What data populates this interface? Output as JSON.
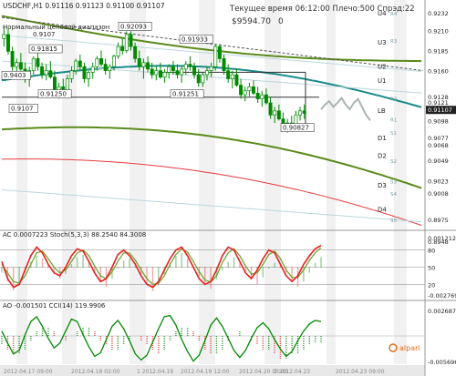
{
  "header": {
    "symbol_line": "USDCHF,H1  0.91116 0.91123 0.91100 0.91107",
    "channel_note": "Нормальный ценовой диапазон",
    "channel_value": "0.9107",
    "server_time": "Текущее время 06:12:00 Плечо:500 Спрэд:22",
    "balance": "$9594.70",
    "balance_change": "0"
  },
  "colors": {
    "background": "#ffffff",
    "gridband": "#e6e6e6",
    "candle": "#008a00",
    "teal_ma": "#1a8a8a",
    "olive_ma": "#5a8a1a",
    "red_ma": "#e83a3a",
    "stoch_red": "#e82020",
    "stoch_green": "#6aa020",
    "hist_red": "#e05050",
    "hist_green": "#3a9a3a"
  },
  "chart_data": [
    {
      "type": "line",
      "title": "USDCHF,H1",
      "ylim": [
        0.8965,
        0.9232
      ],
      "price_axis_labels": [
        "0.9232",
        "0.9210",
        "0.9185",
        "0.9160",
        "0.9128",
        "0.9121",
        "0.9098",
        "0.9077",
        "0.9068",
        "0.9049",
        "0.9023",
        "0.9008",
        "0.8975",
        "0.8948"
      ],
      "current_price": "0.91107",
      "levels": [
        {
          "name": "U4",
          "value": 0.9232
        },
        {
          "name": "U3",
          "value": 0.9196
        },
        {
          "name": "U2",
          "value": 0.9166
        },
        {
          "name": "U1",
          "value": 0.9148
        },
        {
          "name": "LB",
          "value": 0.9111
        },
        {
          "name": "D1",
          "value": 0.9077
        },
        {
          "name": "D2",
          "value": 0.9055
        },
        {
          "name": "D3",
          "value": 0.9018
        },
        {
          "name": "D4",
          "value": 0.8988
        }
      ],
      "level_labels": [
        {
          "name": "R4",
          "value": 0.9232
        },
        {
          "name": "R3",
          "value": 0.9198
        },
        {
          "name": "R2",
          "value": 0.9126
        },
        {
          "name": "R1",
          "value": 0.91
        },
        {
          "name": "S1",
          "value": 0.9084
        },
        {
          "name": "S2",
          "value": 0.9049
        },
        {
          "name": "S3",
          "value": 0.9023
        },
        {
          "name": "S4",
          "value": 0.9008
        },
        {
          "name": "S5",
          "value": 0.8975
        }
      ],
      "price_annotations": [
        {
          "label": "0.9107",
          "value": 0.9107
        },
        {
          "label": "0.91815",
          "value": 0.9181
        },
        {
          "label": "0.92093",
          "value": 0.9209
        },
        {
          "label": "0.91933",
          "value": 0.9193
        },
        {
          "label": "0.9403",
          "value": 0.9148
        },
        {
          "label": "0.91250",
          "value": 0.9125
        },
        {
          "label": "0.91251",
          "value": 0.9125
        },
        {
          "label": "0.90827",
          "value": 0.9083
        }
      ],
      "candles": [
        [
          0.92,
          0.9215,
          0.919,
          0.9205
        ],
        [
          0.9205,
          0.9212,
          0.918,
          0.9184
        ],
        [
          0.9184,
          0.919,
          0.916,
          0.9165
        ],
        [
          0.9165,
          0.9175,
          0.915,
          0.917
        ],
        [
          0.917,
          0.9182,
          0.916,
          0.9162
        ],
        [
          0.9162,
          0.917,
          0.9145,
          0.915
        ],
        [
          0.915,
          0.9165,
          0.914,
          0.916
        ],
        [
          0.916,
          0.9178,
          0.9155,
          0.9175
        ],
        [
          0.9175,
          0.9182,
          0.916,
          0.9165
        ],
        [
          0.9165,
          0.917,
          0.915,
          0.9155
        ],
        [
          0.9155,
          0.9168,
          0.9148,
          0.916
        ],
        [
          0.916,
          0.9172,
          0.915,
          0.9152
        ],
        [
          0.9152,
          0.916,
          0.913,
          0.9135
        ],
        [
          0.9135,
          0.9145,
          0.9125,
          0.914
        ],
        [
          0.914,
          0.915,
          0.9128,
          0.9132
        ],
        [
          0.9132,
          0.9155,
          0.913,
          0.915
        ],
        [
          0.915,
          0.9165,
          0.9145,
          0.916
        ],
        [
          0.916,
          0.9175,
          0.9155,
          0.9172
        ],
        [
          0.9172,
          0.918,
          0.916,
          0.9165
        ],
        [
          0.9165,
          0.917,
          0.9145,
          0.915
        ],
        [
          0.915,
          0.916,
          0.914,
          0.9158
        ],
        [
          0.9158,
          0.917,
          0.915,
          0.9165
        ],
        [
          0.9165,
          0.9178,
          0.916,
          0.9175
        ],
        [
          0.9175,
          0.9185,
          0.9165,
          0.9168
        ],
        [
          0.9168,
          0.9175,
          0.9155,
          0.916
        ],
        [
          0.916,
          0.9168,
          0.915,
          0.9165
        ],
        [
          0.9165,
          0.918,
          0.916,
          0.9178
        ],
        [
          0.9178,
          0.9195,
          0.9175,
          0.919
        ],
        [
          0.919,
          0.92,
          0.918,
          0.9185
        ],
        [
          0.9185,
          0.9209,
          0.9182,
          0.9205
        ],
        [
          0.9205,
          0.9209,
          0.9185,
          0.919
        ],
        [
          0.919,
          0.9195,
          0.917,
          0.9175
        ],
        [
          0.9175,
          0.9185,
          0.916,
          0.9165
        ],
        [
          0.9165,
          0.9175,
          0.915,
          0.917
        ],
        [
          0.917,
          0.9178,
          0.9158,
          0.9162
        ],
        [
          0.9162,
          0.917,
          0.915,
          0.9155
        ],
        [
          0.9155,
          0.9165,
          0.9148,
          0.916
        ],
        [
          0.916,
          0.917,
          0.915,
          0.9152
        ],
        [
          0.9152,
          0.9162,
          0.9145,
          0.9158
        ],
        [
          0.9158,
          0.9168,
          0.915,
          0.9165
        ],
        [
          0.9165,
          0.9172,
          0.9155,
          0.916
        ],
        [
          0.916,
          0.9168,
          0.915,
          0.9155
        ],
        [
          0.9155,
          0.9165,
          0.9145,
          0.9162
        ],
        [
          0.9162,
          0.9172,
          0.9155,
          0.9168
        ],
        [
          0.9168,
          0.9178,
          0.916,
          0.9165
        ],
        [
          0.9165,
          0.917,
          0.915,
          0.9155
        ],
        [
          0.9155,
          0.9162,
          0.914,
          0.9145
        ],
        [
          0.9145,
          0.9158,
          0.914,
          0.9155
        ],
        [
          0.9155,
          0.9165,
          0.9148,
          0.916
        ],
        [
          0.916,
          0.917,
          0.9152,
          0.9165
        ],
        [
          0.9165,
          0.9193,
          0.916,
          0.919
        ],
        [
          0.919,
          0.9193,
          0.917,
          0.9175
        ],
        [
          0.9175,
          0.918,
          0.9155,
          0.916
        ],
        [
          0.916,
          0.9168,
          0.9145,
          0.915
        ],
        [
          0.915,
          0.916,
          0.9138,
          0.9155
        ],
        [
          0.9155,
          0.9162,
          0.914,
          0.9142
        ],
        [
          0.9142,
          0.915,
          0.9125,
          0.913
        ],
        [
          0.913,
          0.914,
          0.9122,
          0.9135
        ],
        [
          0.9135,
          0.9145,
          0.9128,
          0.914
        ],
        [
          0.914,
          0.9148,
          0.913,
          0.9132
        ],
        [
          0.9132,
          0.914,
          0.912,
          0.9125
        ],
        [
          0.9125,
          0.9135,
          0.9115,
          0.913
        ],
        [
          0.913,
          0.9138,
          0.9118,
          0.912
        ],
        [
          0.912,
          0.9128,
          0.91,
          0.9105
        ],
        [
          0.9105,
          0.9115,
          0.9095,
          0.911
        ],
        [
          0.911,
          0.9118,
          0.9098,
          0.91
        ],
        [
          0.91,
          0.9108,
          0.9088,
          0.9092
        ],
        [
          0.9092,
          0.91,
          0.9083,
          0.9095
        ],
        [
          0.9095,
          0.9104,
          0.9085,
          0.909
        ],
        [
          0.909,
          0.911,
          0.9088,
          0.9105
        ],
        [
          0.9105,
          0.9115,
          0.9098,
          0.911
        ],
        [
          0.911,
          0.9118,
          0.91,
          0.9107
        ]
      ],
      "forecast": [
        0.9112,
        0.9118,
        0.9122,
        0.9115,
        0.912,
        0.9126,
        0.9118,
        0.9112,
        0.912,
        0.9125,
        0.9115,
        0.9105,
        0.9098
      ]
    },
    {
      "type": "line",
      "title": "AC 0.0007223  Stoch(5,3,3) 88.2540 84.3008",
      "y_axis_labels": [
        "0.0012125",
        "80",
        "50",
        "20",
        "-0.0027695"
      ],
      "ylim": [
        0,
        100
      ],
      "stoch_main": [
        60,
        30,
        15,
        20,
        45,
        70,
        85,
        75,
        55,
        40,
        35,
        50,
        70,
        82,
        78,
        60,
        40,
        25,
        30,
        50,
        72,
        80,
        70,
        55,
        35,
        20,
        15,
        25,
        45,
        65,
        80,
        85,
        70,
        50,
        30,
        20,
        25,
        45,
        70,
        85,
        80,
        60,
        40,
        30,
        45,
        65,
        80,
        75,
        55,
        35,
        25,
        35,
        55,
        70,
        82,
        88
      ],
      "stoch_signal": [
        55,
        40,
        25,
        22,
        35,
        55,
        75,
        78,
        65,
        50,
        40,
        45,
        60,
        75,
        80,
        70,
        52,
        35,
        30,
        42,
        60,
        75,
        75,
        62,
        45,
        30,
        20,
        22,
        35,
        55,
        72,
        82,
        76,
        60,
        42,
        28,
        24,
        35,
        58,
        75,
        82,
        70,
        52,
        38,
        40,
        55,
        72,
        78,
        65,
        45,
        32,
        32,
        45,
        62,
        75,
        84
      ],
      "ac_histogram": [
        -0.0004,
        -0.001,
        -0.0016,
        -0.0012,
        -0.0003,
        0.0004,
        0.0008,
        0.0006,
        0.0002,
        -0.0004,
        -0.0008,
        -0.0005,
        0.0002,
        0.0007,
        0.0009,
        0.0004,
        -0.0003,
        -0.001,
        -0.0014,
        -0.0008,
        -0.0001,
        0.0005,
        0.0006,
        0.0001,
        -0.0005,
        -0.0011,
        -0.0017,
        -0.0013,
        -0.0005,
        0.0003,
        0.0008,
        0.001,
        0.0006,
        0.0001,
        -0.0006,
        -0.0012,
        -0.0015,
        -0.0009,
        -0.0002,
        0.0004,
        0.0007,
        0.0003,
        -0.0003,
        -0.0009,
        -0.0012,
        -0.0007,
        -0.0001,
        0.0003,
        0.0002,
        -0.0004,
        -0.001,
        -0.0014,
        -0.001,
        -0.0004,
        0.0003,
        0.0007
      ]
    },
    {
      "type": "line",
      "title": "AO -0.001501  CCI(14) 119.9906",
      "y_axis_labels": [
        "0.0026875",
        "-0.0056966"
      ],
      "cci": [
        40,
        -60,
        -150,
        -120,
        10,
        120,
        160,
        80,
        -20,
        -100,
        -60,
        40,
        140,
        120,
        10,
        -90,
        -170,
        -140,
        -30,
        80,
        130,
        60,
        -40,
        -150,
        -200,
        -160,
        -50,
        60,
        160,
        170,
        90,
        -30,
        -130,
        -210,
        -160,
        -40,
        90,
        150,
        80,
        -20,
        -120,
        -180,
        -120,
        -20,
        70,
        110,
        60,
        -30,
        -110,
        -170,
        -130,
        -40,
        40,
        100,
        130,
        120
      ],
      "ao_histogram": [
        -0.002,
        -0.003,
        -0.004,
        -0.004,
        -0.003,
        -0.001,
        0.001,
        0.002,
        0.002,
        0.001,
        0.0,
        -0.001,
        0.0,
        0.001,
        0.002,
        0.002,
        0.001,
        -0.001,
        -0.002,
        -0.003,
        -0.003,
        -0.002,
        -0.001,
        0.0,
        -0.001,
        -0.002,
        -0.003,
        -0.004,
        -0.003,
        -0.001,
        0.001,
        0.002,
        0.002,
        0.001,
        -0.001,
        -0.003,
        -0.004,
        -0.004,
        -0.003,
        -0.001,
        0.0,
        0.001,
        0.0,
        -0.001,
        -0.002,
        -0.003,
        -0.003,
        -0.004,
        -0.005,
        -0.005,
        -0.004,
        -0.004,
        -0.003,
        -0.002,
        -0.0015,
        -0.0015
      ]
    }
  ],
  "time_axis": [
    "2012.04.17 09:00",
    "2012.04.18 02:00",
    "1 2012.04.19",
    "2012.04.19 12:00",
    "2012.04.20 03:00",
    "2 2012.04.23",
    "2012.04.23 09:00"
  ],
  "logo": "alpari"
}
